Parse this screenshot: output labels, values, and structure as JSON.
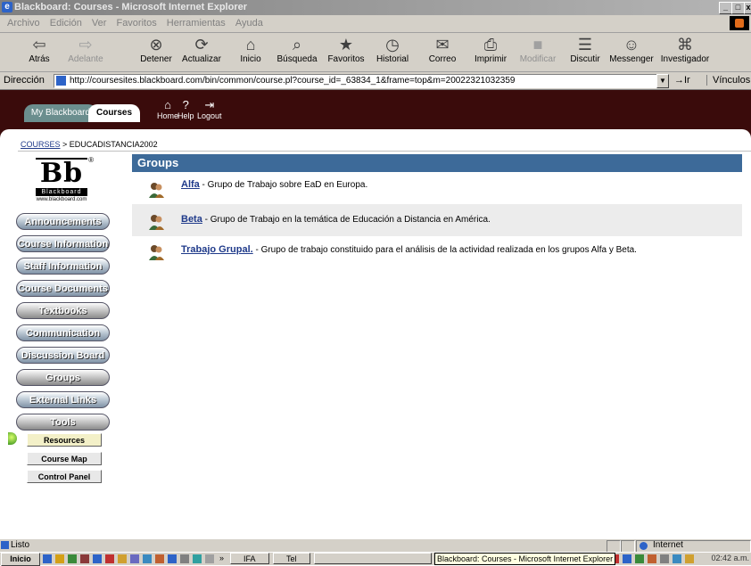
{
  "window": {
    "title": "Blackboard: Courses - Microsoft Internet Explorer",
    "minimize": "_",
    "maximize": "□",
    "close": "x"
  },
  "menu": [
    "Archivo",
    "Edición",
    "Ver",
    "Favoritos",
    "Herramientas",
    "Ayuda"
  ],
  "toolbar": [
    {
      "label": "Atrás",
      "icon": "⇦",
      "name": "back",
      "disabled": false
    },
    {
      "label": "Adelante",
      "icon": "⇨",
      "name": "forward",
      "disabled": true
    },
    {
      "label": "Detener",
      "icon": "⊗",
      "name": "stop",
      "disabled": false
    },
    {
      "label": "Actualizar",
      "icon": "⟳",
      "name": "refresh",
      "disabled": false
    },
    {
      "label": "Inicio",
      "icon": "⌂",
      "name": "home",
      "disabled": false
    },
    {
      "label": "Búsqueda",
      "icon": "⌕",
      "name": "search",
      "disabled": false
    },
    {
      "label": "Favoritos",
      "icon": "★",
      "name": "favorites",
      "disabled": false
    },
    {
      "label": "Historial",
      "icon": "◷",
      "name": "history",
      "disabled": false
    },
    {
      "label": "Correo",
      "icon": "✉",
      "name": "mail",
      "disabled": false
    },
    {
      "label": "Imprimir",
      "icon": "⎙",
      "name": "print",
      "disabled": false
    },
    {
      "label": "Modificar",
      "icon": "■",
      "name": "edit",
      "disabled": true
    },
    {
      "label": "Discutir",
      "icon": "☰",
      "name": "discuss",
      "disabled": false
    },
    {
      "label": "Messenger",
      "icon": "☺",
      "name": "messenger",
      "disabled": false
    },
    {
      "label": "Investigador",
      "icon": "⌘",
      "name": "research",
      "disabled": false
    }
  ],
  "address": {
    "label": "Dirección",
    "url": "http://coursesites.blackboard.com/bin/common/course.pl?course_id=_63834_1&frame=top&m=20022321032359",
    "go": "→Ir",
    "links": "Vínculos"
  },
  "header": {
    "tab_mybb": "My Blackboard",
    "tab_courses": "Courses",
    "home": "Home",
    "help": "Help",
    "logout": "Logout"
  },
  "breadcrumb": {
    "courses": "COURSES",
    "sep": " > ",
    "current": "EDUCADISTANCIA2002"
  },
  "logo": {
    "letters": "Bb",
    "word": "Blackboard",
    "site": "www.blackboard.com",
    "reg": "®"
  },
  "nav": [
    "Announcements",
    "Course Information",
    "Staff Information",
    "Course Documents",
    "Textbooks",
    "Communication",
    "Discussion Board",
    "Groups",
    "External Links",
    "Tools"
  ],
  "tools_sub": [
    "Resources",
    "Course Map",
    "Control Panel"
  ],
  "groups": {
    "title": "Groups",
    "items": [
      {
        "name": "Alfa",
        "desc": " - Grupo de Trabajo sobre EaD en Europa."
      },
      {
        "name": "Beta",
        "desc": " - Grupo de Trabajo en la temática de Educación a Distancia en América."
      },
      {
        "name": "Trabajo Grupal.",
        "desc": " - Grupo de trabajo constituido para el análisis de la actividad realizada en los grupos Alfa y Beta."
      }
    ]
  },
  "status": {
    "text": "Listo",
    "zone": "Internet"
  },
  "taskbar": {
    "start": "Inicio",
    "chevron": "»",
    "btn1": "IFA",
    "btn2": "Tel",
    "tooltip": "Blackboard: Courses - Microsoft Internet Explorer",
    "clock": "02:42 a.m."
  },
  "colors": {
    "groups_header": "#3d6a99",
    "bb_header": "#3a0b0b",
    "link": "#1f3a8a"
  }
}
